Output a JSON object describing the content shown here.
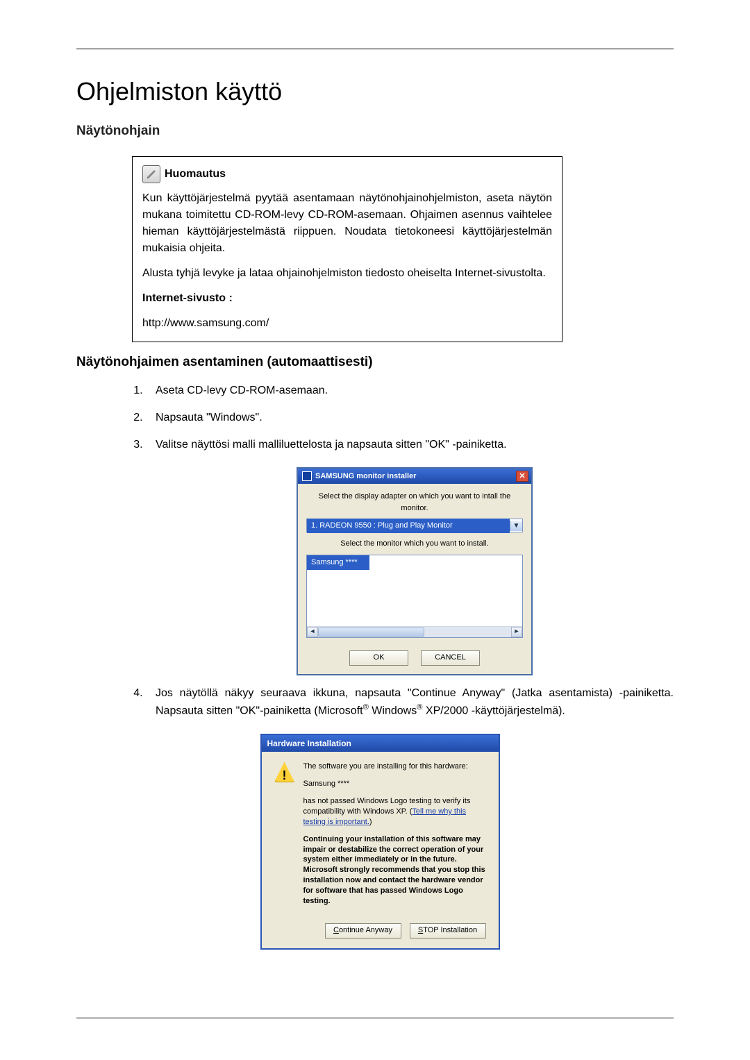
{
  "heading": "Ohjelmiston käyttö",
  "section1": "Näytönohjain",
  "note": {
    "title": "Huomautus",
    "p1": "Kun käyttöjärjestelmä pyytää asentamaan näytönohjainohjelmiston, aseta näytön mukana toimitettu CD-ROM-levy CD-ROM-asemaan. Ohjaimen asennus vaihtelee hieman käyttöjärjestelmästä riippuen. Noudata tietokoneesi käyttöjärjestelmän mukaisia ohjeita.",
    "p2": "Alusta tyhjä levyke ja lataa ohjainohjelmiston tiedosto oheiselta Internet-sivustolta.",
    "site_label": "Internet-sivusto :",
    "url": "http://www.samsung.com/"
  },
  "section2": "Näytönohjaimen asentaminen (automaattisesti)",
  "steps": {
    "s1": "Aseta CD-levy CD-ROM-asemaan.",
    "s2": "Napsauta \"Windows\".",
    "s3": "Valitse näyttösi malli malliluettelosta ja napsauta sitten \"OK\" -painiketta.",
    "s4a": "Jos näytöllä näkyy seuraava ikkuna, napsauta \"Continue Anyway\" (Jatka asentamista) -painiketta. Napsauta sitten \"OK\"-painiketta (Microsoft",
    "s4b": " Windows",
    "s4c": " XP/2000 -käyttöjärjestelmä).",
    "reg": "®"
  },
  "dlg1": {
    "title": "SAMSUNG monitor installer",
    "line1": "Select the display adapter on which you want to intall the monitor.",
    "combo": "1. RADEON 9550 : Plug and Play Monitor",
    "line2": "Select the monitor which you want to install.",
    "listItem": "Samsung ****",
    "ok": "OK",
    "cancel": "CANCEL"
  },
  "dlg2": {
    "title": "Hardware Installation",
    "p1": "The software you are installing for this hardware:",
    "p2": "Samsung ****",
    "p3a": "has not passed Windows Logo testing to verify its compatibility with Windows XP. (",
    "p3link": "Tell me why this testing is important.",
    "p3b": ")",
    "p4": "Continuing your installation of this software may impair or destabilize the correct operation of your system either immediately or in the future. Microsoft strongly recommends that you stop this installation now and contact the hardware vendor for software that has passed Windows Logo testing.",
    "btn1_u": "C",
    "btn1_rest": "ontinue Anyway",
    "btn2_u": "S",
    "btn2_rest": "TOP Installation"
  }
}
